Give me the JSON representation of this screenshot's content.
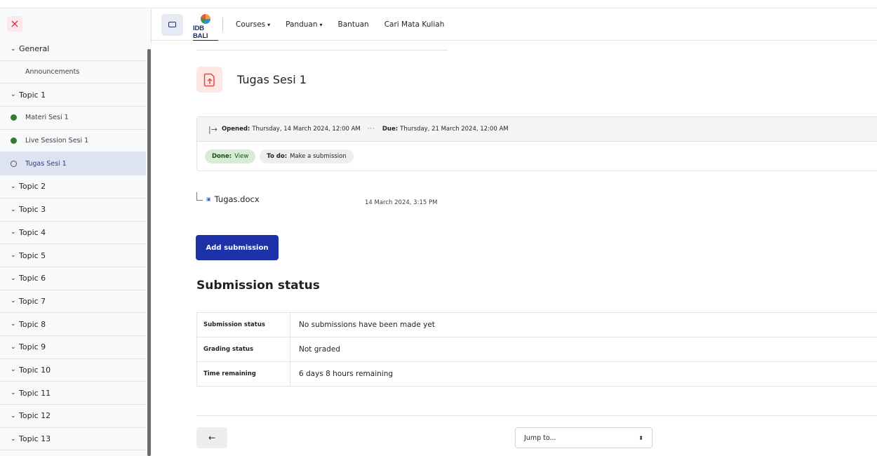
{
  "sidebar": {
    "close_icon": "×",
    "items": [
      {
        "type": "section",
        "label": "General"
      },
      {
        "type": "plain",
        "label": "Announcements"
      },
      {
        "type": "section",
        "label": "Topic 1"
      },
      {
        "type": "activity",
        "status": "complete",
        "label": "Materi Sesi 1"
      },
      {
        "type": "activity",
        "status": "complete",
        "label": "Live Session Sesi 1"
      },
      {
        "type": "activity",
        "status": "incomplete",
        "label": "Tugas Sesi 1",
        "current": true
      },
      {
        "type": "section",
        "label": "Topic 2"
      },
      {
        "type": "section",
        "label": "Topic 3"
      },
      {
        "type": "section",
        "label": "Topic 4"
      },
      {
        "type": "section",
        "label": "Topic 5"
      },
      {
        "type": "section",
        "label": "Topic 6"
      },
      {
        "type": "section",
        "label": "Topic 7"
      },
      {
        "type": "section",
        "label": "Topic 8"
      },
      {
        "type": "section",
        "label": "Topic 9"
      },
      {
        "type": "section",
        "label": "Topic 10"
      },
      {
        "type": "section",
        "label": "Topic 11"
      },
      {
        "type": "section",
        "label": "Topic 12"
      },
      {
        "type": "section",
        "label": "Topic 13"
      }
    ]
  },
  "navbar": {
    "logo_text": "IDB BALI",
    "links": [
      {
        "label": "Courses",
        "dropdown": true
      },
      {
        "label": "Panduan",
        "dropdown": true
      },
      {
        "label": "Bantuan",
        "dropdown": false
      },
      {
        "label": "Cari Mata Kuliah",
        "dropdown": false
      }
    ]
  },
  "main": {
    "title": "Tugas Sesi 1",
    "dates": {
      "opened_label": "Opened:",
      "opened_value": "Thursday, 14 March 2024, 12:00 AM",
      "due_label": "Due:",
      "due_value": "Thursday, 21 March 2024, 12:00 AM"
    },
    "completion": {
      "done_label": "Done:",
      "done_value": "View",
      "todo_label": "To do:",
      "todo_value": "Make a submission"
    },
    "file": {
      "name": "Tugas.docx",
      "date": "14 March 2024, 3:15 PM"
    },
    "add_submission_label": "Add submission",
    "status_heading": "Submission status",
    "status_rows": [
      {
        "label": "Submission status",
        "value": "No submissions have been made yet"
      },
      {
        "label": "Grading status",
        "value": "Not graded"
      },
      {
        "label": "Time remaining",
        "value": "6 days 8 hours remaining"
      }
    ],
    "prev_arrow": "←",
    "jump_to_label": "Jump to..."
  },
  "colors": {
    "primary": "#1d31a8",
    "done_badge": "#d7ecd4",
    "complete_dot": "#357a32",
    "current_item_bg": "#dde3f2",
    "close_red": "#d9303e"
  }
}
